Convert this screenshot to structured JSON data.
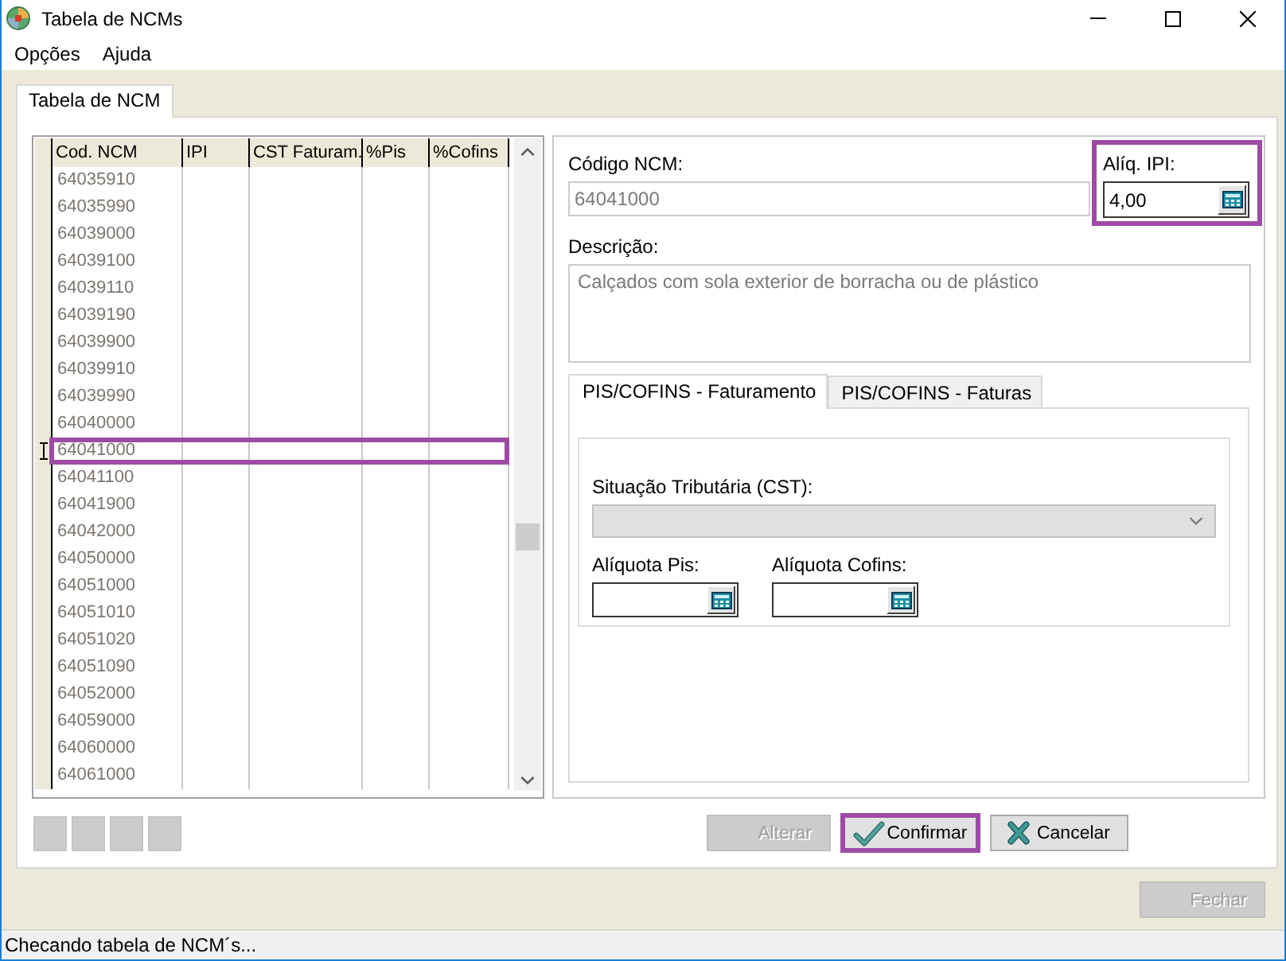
{
  "window": {
    "title": "Tabela de NCMs"
  },
  "menu": [
    {
      "label": "Opções"
    },
    {
      "label": "Ajuda"
    }
  ],
  "tabs": [
    {
      "label": "Tabela de NCM",
      "selected": true
    }
  ],
  "grid": {
    "columns": [
      "Cod. NCM",
      "IPI",
      "CST Faturam.",
      "%Pis",
      "%Cofins"
    ],
    "rows": [
      {
        "cod_ncm": "64035910",
        "selected": false
      },
      {
        "cod_ncm": "64035990",
        "selected": false
      },
      {
        "cod_ncm": "64039000",
        "selected": false
      },
      {
        "cod_ncm": "64039100",
        "selected": false
      },
      {
        "cod_ncm": "64039110",
        "selected": false
      },
      {
        "cod_ncm": "64039190",
        "selected": false
      },
      {
        "cod_ncm": "64039900",
        "selected": false
      },
      {
        "cod_ncm": "64039910",
        "selected": false
      },
      {
        "cod_ncm": "64039990",
        "selected": false
      },
      {
        "cod_ncm": "64040000",
        "selected": false
      },
      {
        "cod_ncm": "64041000",
        "selected": true
      },
      {
        "cod_ncm": "64041100",
        "selected": false
      },
      {
        "cod_ncm": "64041900",
        "selected": false
      },
      {
        "cod_ncm": "64042000",
        "selected": false
      },
      {
        "cod_ncm": "64050000",
        "selected": false
      },
      {
        "cod_ncm": "64051000",
        "selected": false
      },
      {
        "cod_ncm": "64051010",
        "selected": false
      },
      {
        "cod_ncm": "64051020",
        "selected": false
      },
      {
        "cod_ncm": "64051090",
        "selected": false
      },
      {
        "cod_ncm": "64052000",
        "selected": false
      },
      {
        "cod_ncm": "64059000",
        "selected": false
      },
      {
        "cod_ncm": "64060000",
        "selected": false
      },
      {
        "cod_ncm": "64061000",
        "selected": false
      }
    ]
  },
  "nav_buttons": [
    {
      "disabled": true
    },
    {
      "disabled": true
    },
    {
      "disabled": true
    },
    {
      "disabled": true
    }
  ],
  "form": {
    "codigo_ncm": {
      "label": "Código NCM:",
      "value": "64041000",
      "disabled": true
    },
    "aliq_ipi": {
      "label": "Alíq. IPI:",
      "value": "4,00",
      "disabled": false,
      "highlighted": true
    },
    "descricao": {
      "label": "Descrição:",
      "value": "Calçados com sola exterior de borracha ou de plástico",
      "disabled": true
    },
    "tabs": [
      {
        "label": "PIS/COFINS - Faturamento",
        "selected": true
      },
      {
        "label": "PIS/COFINS - Faturas",
        "selected": false
      }
    ],
    "cst": {
      "label": "Situação Tributária (CST):",
      "disabled": true
    },
    "aliquota_pis": {
      "label": "Alíquota Pis:",
      "disabled": false
    },
    "aliquota_cofins": {
      "label": "Alíquota Cofins:",
      "disabled": false
    }
  },
  "buttons": [
    {
      "kind": "edit",
      "label": "Alterar",
      "disabled": true,
      "highlighted": false
    },
    {
      "kind": "confirm",
      "label": "Confirmar",
      "disabled": false,
      "highlighted": true
    },
    {
      "kind": "cancel",
      "label": "Cancelar",
      "disabled": false,
      "highlighted": false
    }
  ],
  "footer_buttons": [
    {
      "kind": "close",
      "label": "Fechar",
      "disabled": true,
      "highlighted": false
    }
  ],
  "status_bar": {
    "text": "Checando tabela de NCM´s..."
  }
}
